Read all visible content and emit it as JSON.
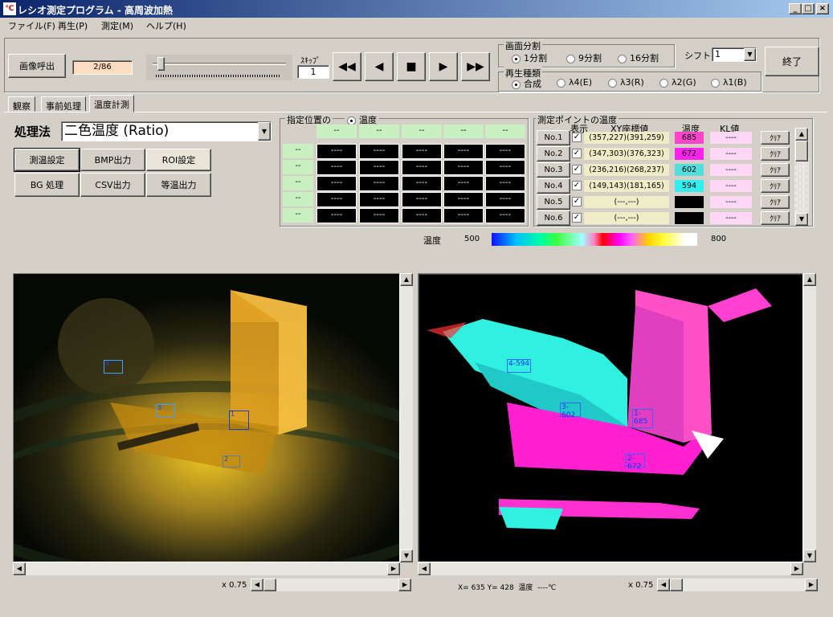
{
  "window": {
    "title": "レシオ測定プログラム - 高周波加熱",
    "icon_text": "℃"
  },
  "menu": [
    "ファイル(F)",
    "再生(P)",
    "測定(M)",
    "ヘルプ(H)"
  ],
  "toolbar": {
    "load_image_label": "画像呼出",
    "frame_counter": "2/86",
    "skip_label": "ｽｷｯﾌﾟ",
    "skip_value": "1",
    "playback_position": 0.04,
    "exit_label": "終了"
  },
  "screen_split": {
    "title": "画面分割",
    "options": [
      "1分割",
      "9分割",
      "16分割"
    ],
    "selected": 0,
    "shift_label": "シフト",
    "shift_value": "1"
  },
  "playback_type": {
    "title": "再生種類",
    "options": [
      "合成",
      "λ4(E)",
      "λ3(R)",
      "λ2(G)",
      "λ1(B)"
    ],
    "selected": 0
  },
  "tabs": [
    "観察",
    "事前処理",
    "温度計測"
  ],
  "active_tab": 2,
  "method": {
    "label": "処理法",
    "value": "二色温度 (Ratio)"
  },
  "action_buttons": [
    "測温設定",
    "BMP出力",
    "ROI設定",
    "BG 処理",
    "CSV出力",
    "等温出力"
  ],
  "position_table": {
    "title": "指定位置の",
    "radio_label": "温度",
    "col_headers": [
      "--",
      "--",
      "--",
      "--",
      "--"
    ],
    "row_headers": [
      "--",
      "--",
      "--",
      "--",
      "--"
    ],
    "cell_value": "----"
  },
  "measure_points": {
    "title": "測定ポイントの温度",
    "headers": {
      "show": "表示",
      "xy": "XY座標値",
      "temp": "温度",
      "kl": "KL値"
    },
    "clear_label": "ｸﾘｱ",
    "rows": [
      {
        "no": "No.1",
        "xy": "(357,227)(391,259)",
        "temp": "685",
        "color": "#ff44cc",
        "kl": "----"
      },
      {
        "no": "No.2",
        "xy": "(347,303)(376,323)",
        "temp": "672",
        "color": "#ff22ee",
        "kl": "----"
      },
      {
        "no": "No.3",
        "xy": "(236,216)(268,237)",
        "temp": "602",
        "color": "#55dddd",
        "kl": "----"
      },
      {
        "no": "No.4",
        "xy": "(149,143)(181,165)",
        "temp": "594",
        "color": "#33eeee",
        "kl": "----"
      },
      {
        "no": "No.5",
        "xy": "(---,---)",
        "temp": "",
        "color": "#000000",
        "kl": "----"
      },
      {
        "no": "No.6",
        "xy": "(---,---)",
        "temp": "",
        "color": "#000000",
        "kl": "----"
      }
    ]
  },
  "colorbar": {
    "label": "温度",
    "min": "500",
    "max": "800"
  },
  "left_view": {
    "zoom": "x 0.75",
    "rois": [
      "1",
      "2",
      "3",
      "4"
    ]
  },
  "right_view": {
    "zoom": "x 0.75",
    "rois": [
      "1-685",
      "2-672",
      "3-602",
      "4-594"
    ]
  },
  "status": {
    "text": "X= 635 Y= 428  温度  ----℃"
  }
}
